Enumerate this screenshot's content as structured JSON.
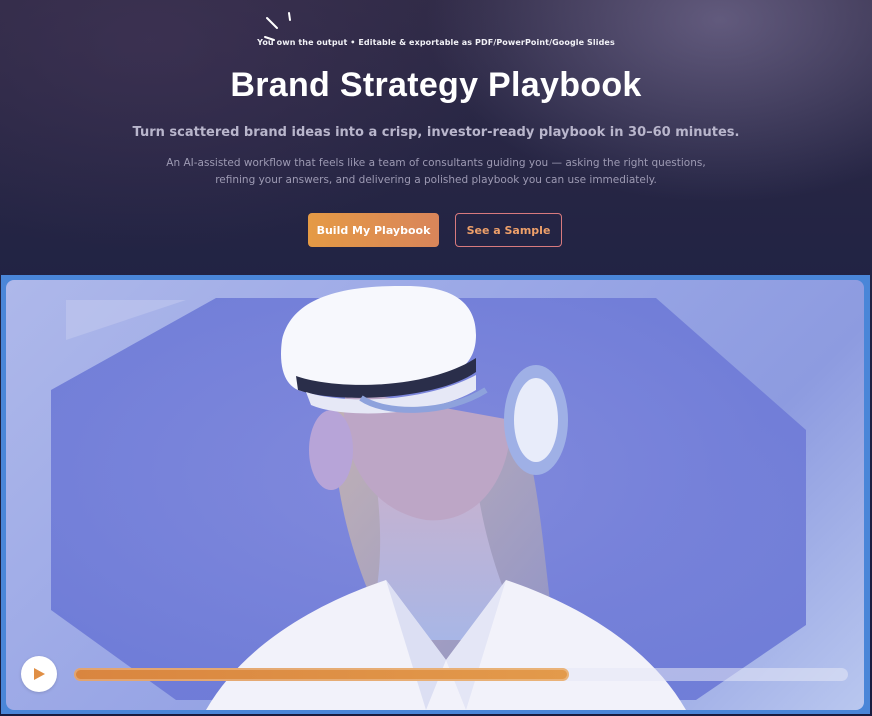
{
  "hero": {
    "eyebrow": "You own the output • Editable & exportable as PDF/PowerPoint/Google Slides",
    "title": "Brand Strategy Playbook",
    "subtitle": "Turn scattered brand ideas into a crisp, investor-ready playbook in 30–60 minutes.",
    "description": "An AI-assisted workflow that feels like a team of consultants guiding you — asking the right questions, refining your answers, and delivering a polished playbook you can use immediately.",
    "primary_cta": "Build My Playbook",
    "secondary_cta": "See a Sample"
  },
  "video": {
    "play_icon": "play-icon",
    "progress": 0.64
  },
  "colors": {
    "accent": "#e08f45",
    "frame": "#4a86d8"
  }
}
